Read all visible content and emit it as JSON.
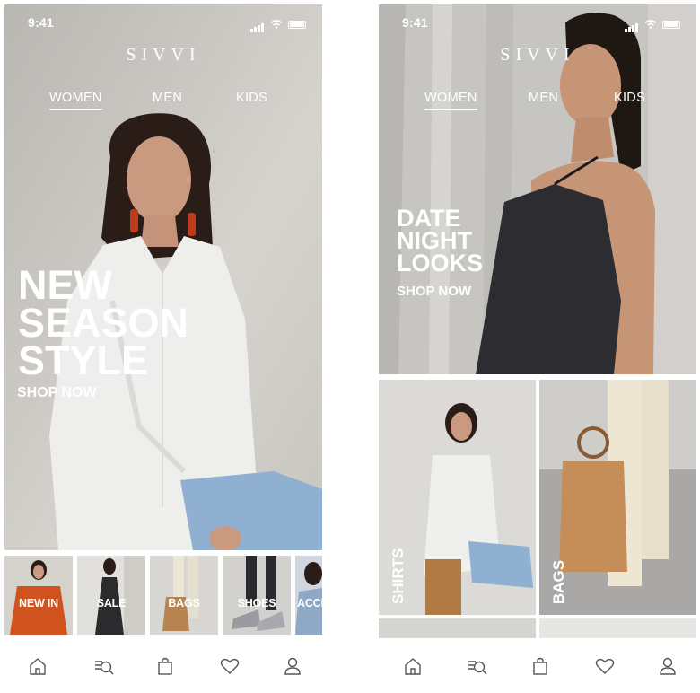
{
  "status": {
    "time": "9:41"
  },
  "brand": "SIVVI",
  "nav": {
    "tabs": [
      "WOMEN",
      "MEN",
      "KIDS"
    ],
    "active": "WOMEN"
  },
  "screens": {
    "left": {
      "headline": [
        "NEW",
        "SEASON",
        "STYLE"
      ],
      "cta": "SHOP NOW",
      "categories": [
        "NEW IN",
        "SALE",
        "BAGS",
        "SHOES",
        "ACCE"
      ]
    },
    "right": {
      "headline": [
        "DATE",
        "NIGHT",
        "LOOKS"
      ],
      "cta": "SHOP NOW",
      "tiles": [
        "SHIRTS",
        "BAGS"
      ]
    }
  },
  "tabbar": {
    "icons": [
      "home-icon",
      "search-list-icon",
      "shopping-bag-icon",
      "heart-icon",
      "user-icon"
    ]
  },
  "colors": {
    "hero_bg": "#c9c6c0",
    "headline": "#ffffff",
    "icon_stroke": "#555555"
  }
}
